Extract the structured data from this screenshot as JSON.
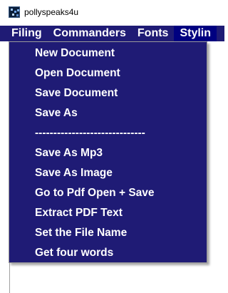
{
  "window": {
    "title": "pollyspeaks4u",
    "icon": "app-logo-icon"
  },
  "menubar": {
    "items": [
      {
        "label": "Filing"
      },
      {
        "label": "Commanders"
      },
      {
        "label": "Fonts"
      },
      {
        "label": "Stylin"
      }
    ]
  },
  "dropdown": {
    "items": [
      {
        "label": "New Document"
      },
      {
        "label": "Open Document"
      },
      {
        "label": "Save Document"
      },
      {
        "label": "Save As"
      },
      {
        "label": "------------------------------"
      },
      {
        "label": "Save As Mp3"
      },
      {
        "label": "Save As Image"
      },
      {
        "label": "Go to Pdf Open + Save"
      },
      {
        "label": "Extract PDF Text"
      },
      {
        "label": "Set the File Name"
      },
      {
        "label": "Get four words"
      }
    ]
  },
  "colors": {
    "menu_background": "#1f1b75",
    "active_menu": "#000080",
    "text": "#ffffff"
  }
}
